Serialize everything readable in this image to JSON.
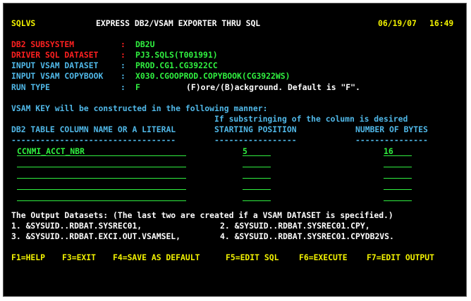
{
  "header": {
    "screen_id": "SQLVS",
    "title": "EXPRESS DB2/VSAM EXPORTER THRU SQL",
    "date": "06/19/07",
    "time": "16:49"
  },
  "params": [
    {
      "label": "DB2 SUBSYSTEM     ",
      "sep": ":",
      "value": "DB2U"
    },
    {
      "label": "DRIVER SQL DATASET",
      "sep": ":",
      "value": "PJ3.SQLS(T001991)"
    },
    {
      "label": "INPUT VSAM DATASET",
      "sep": ":",
      "value": "PROD.CG1.CG3922CC"
    },
    {
      "label": "INPUT VSAM COPYBOOK",
      "sep": ":",
      "value": "X030.CGOOPROD.COPYBOOK(CG3922WS)"
    },
    {
      "label": "RUN TYPE          ",
      "sep": ":",
      "value": "F",
      "hint": "(F)ore/(B)ackground. Default is \"F\"."
    }
  ],
  "vsam_key": {
    "intro": "VSAM KEY will be constructed in the following manner:",
    "substring_note": "If substringing of the column is desired",
    "col_headers": {
      "column": "DB2 TABLE COLUMN NAME OR A LITERAL",
      "start": "STARTING POSITION",
      "bytes": "NUMBER OF BYTES"
    },
    "col_underlines": {
      "column": "----------------------------------",
      "start": "-----------------",
      "bytes": "---------------"
    },
    "rows": [
      {
        "column": "CCNMI_ACCT_NBR",
        "start": "5",
        "bytes": "16"
      },
      {
        "column": "",
        "start": "",
        "bytes": ""
      },
      {
        "column": "",
        "start": "",
        "bytes": ""
      },
      {
        "column": "",
        "start": "",
        "bytes": ""
      },
      {
        "column": "",
        "start": "",
        "bytes": ""
      }
    ]
  },
  "outputs": {
    "intro": "The Output Datasets: (The last two are created if a VSAM DATASET is specified.)",
    "line1a": "1. &SYSUID..RDBAT.SYSREC01,",
    "line1b": "2. &SYSUID..RDBAT.SYSREC01.CPY,",
    "line2a": "3. &SYSUID..RDBAT.EXCI.OUT.VSAMSEL,",
    "line2b": "4. &SYSUID..RDBAT.SYSREC01.CPYDB2VS."
  },
  "pfkeys": [
    {
      "key": "F1=HELP"
    },
    {
      "key": "F3=EXIT"
    },
    {
      "key": "F4=SAVE AS DEFAULT"
    },
    {
      "key": "F5=EDIT SQL"
    },
    {
      "key": "F6=EXECUTE"
    },
    {
      "key": "F7=EDIT OUTPUT"
    }
  ],
  "colors": {
    "background": "#000000",
    "yellow": "#f2f200",
    "red": "#ff2020",
    "cyan": "#50b8e8",
    "green": "#30f040",
    "white": "#ffffff"
  }
}
